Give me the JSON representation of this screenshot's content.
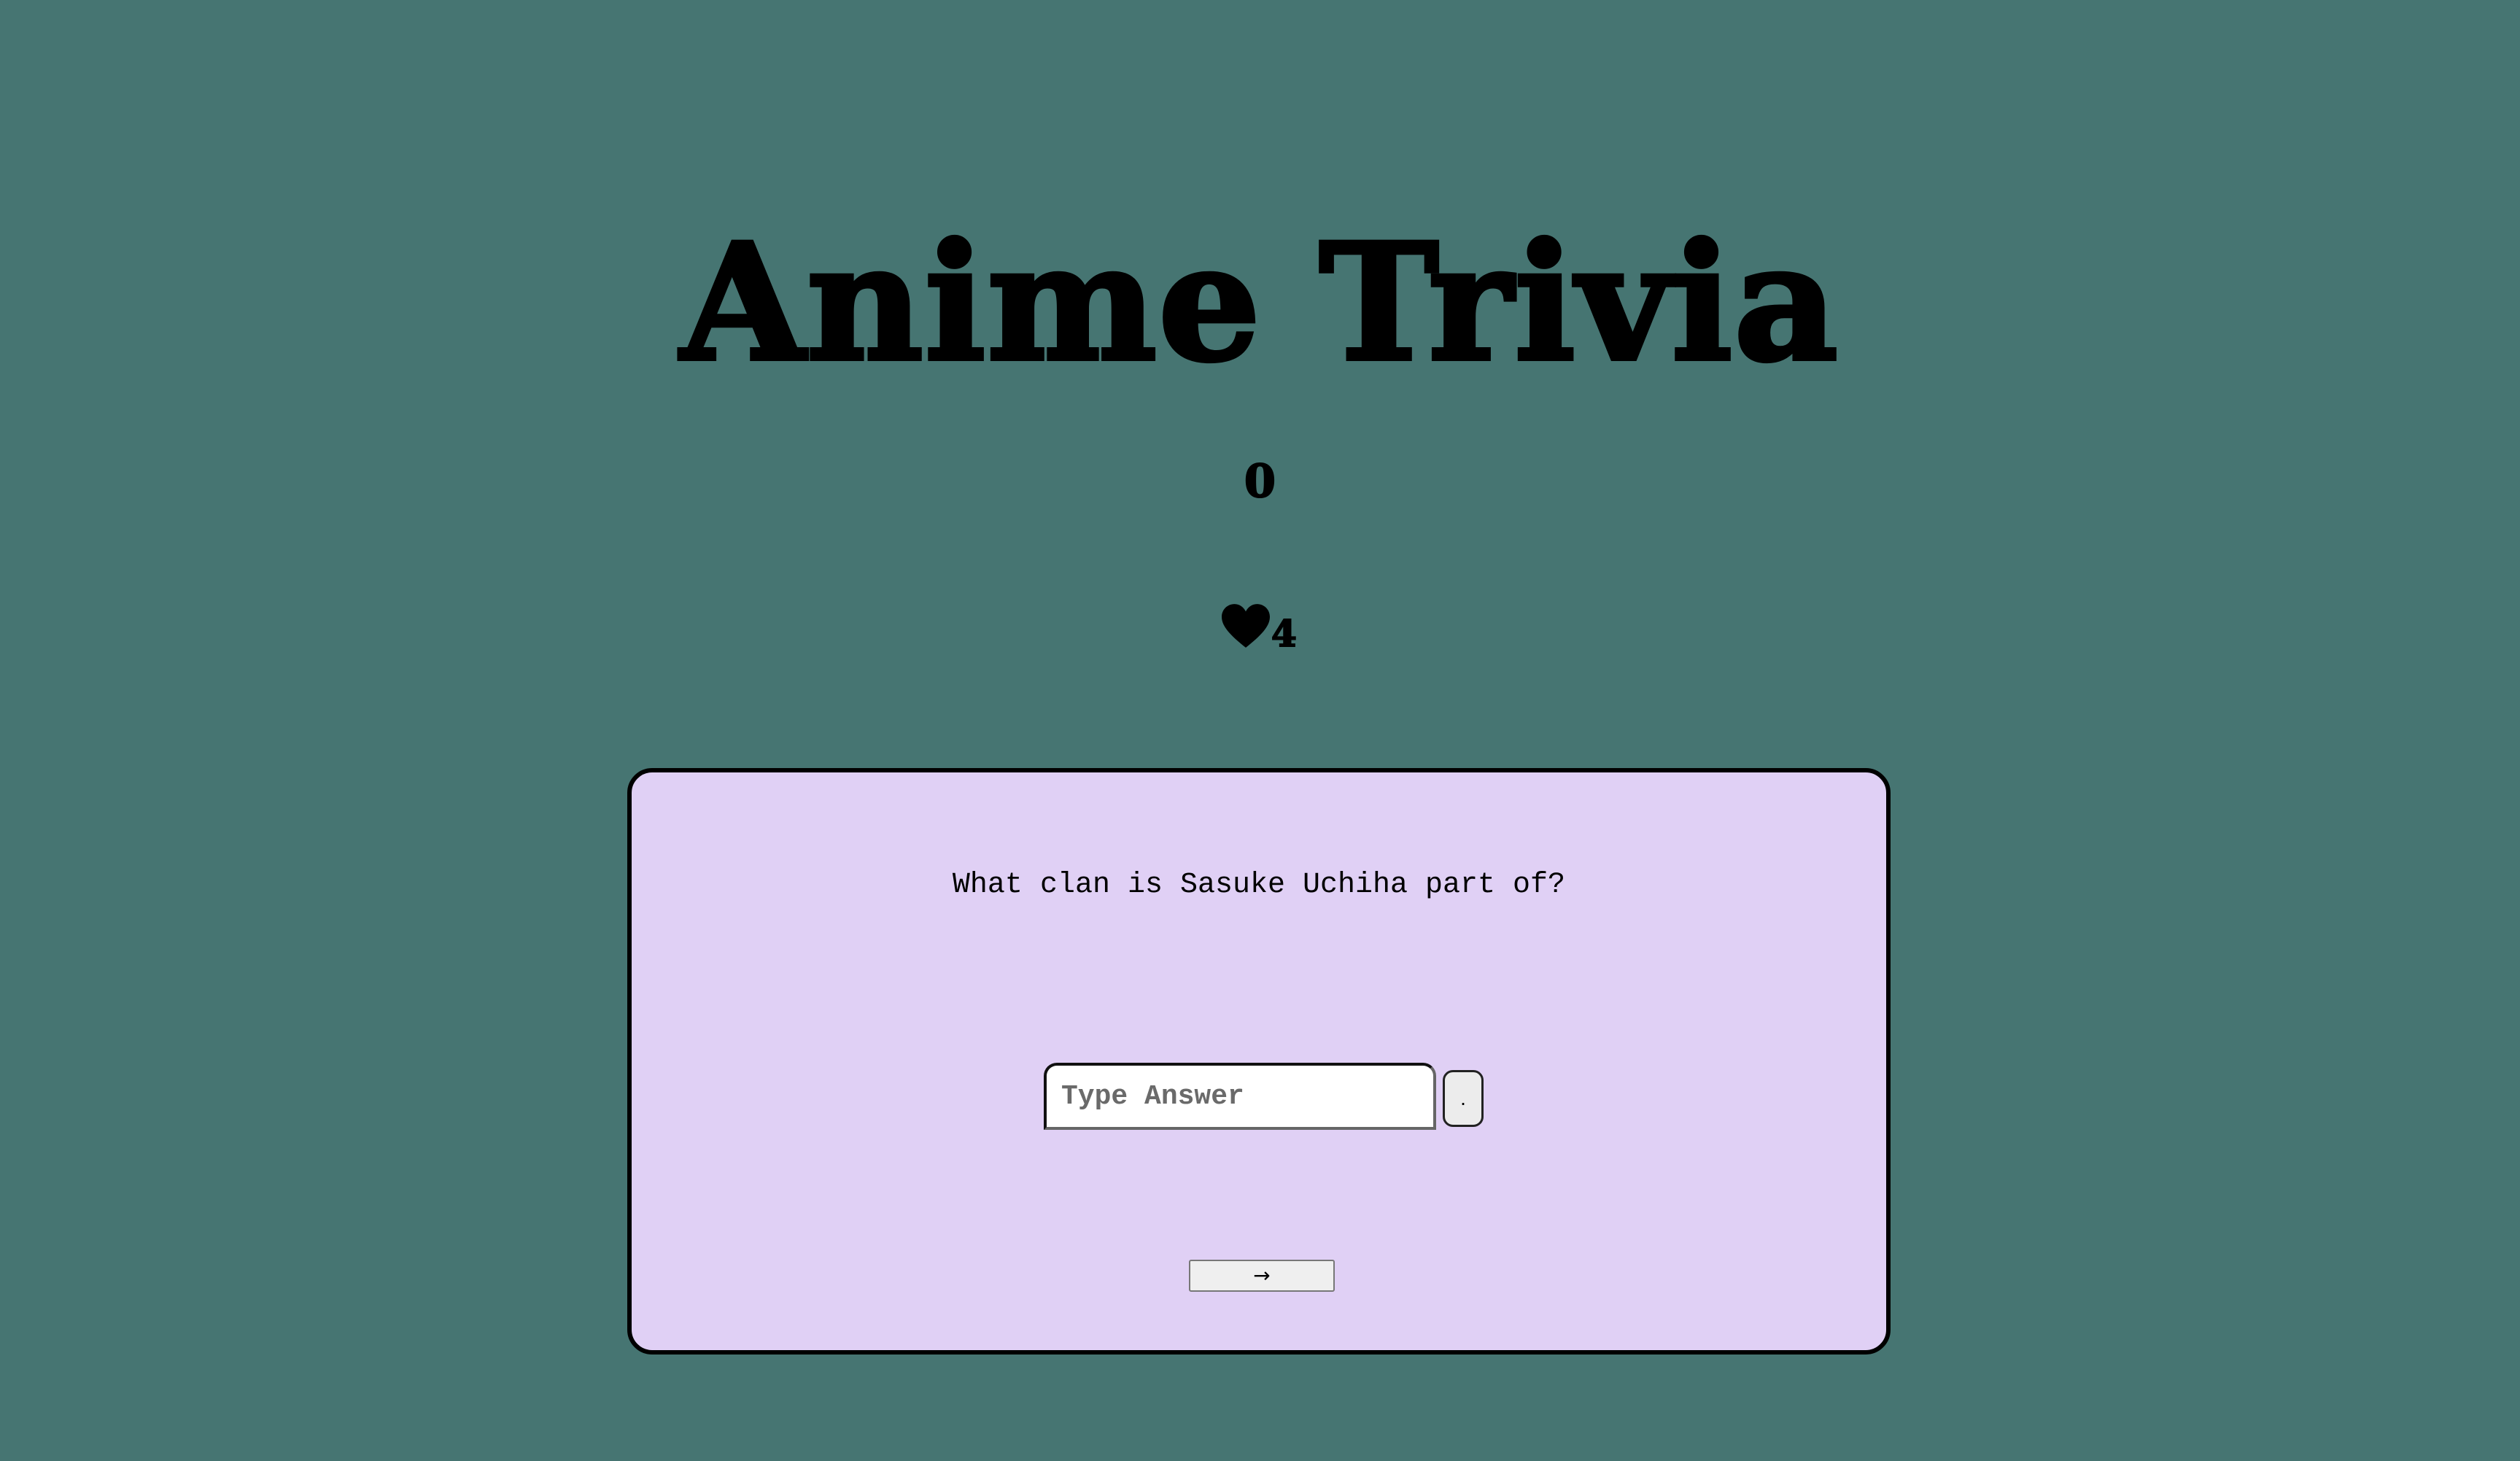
{
  "app": {
    "title": "Anime Trivia"
  },
  "status": {
    "score": "0",
    "lives": "4",
    "lives_icon": "heart-icon"
  },
  "quiz": {
    "question": "What clan is Sasuke Uchiha part of?",
    "answer_placeholder": "Type Answer",
    "answer_value": "",
    "hint_label": ".",
    "next_label": "→"
  },
  "colors": {
    "background": "#467572",
    "card": "#e0d0f5",
    "text": "#000000"
  }
}
